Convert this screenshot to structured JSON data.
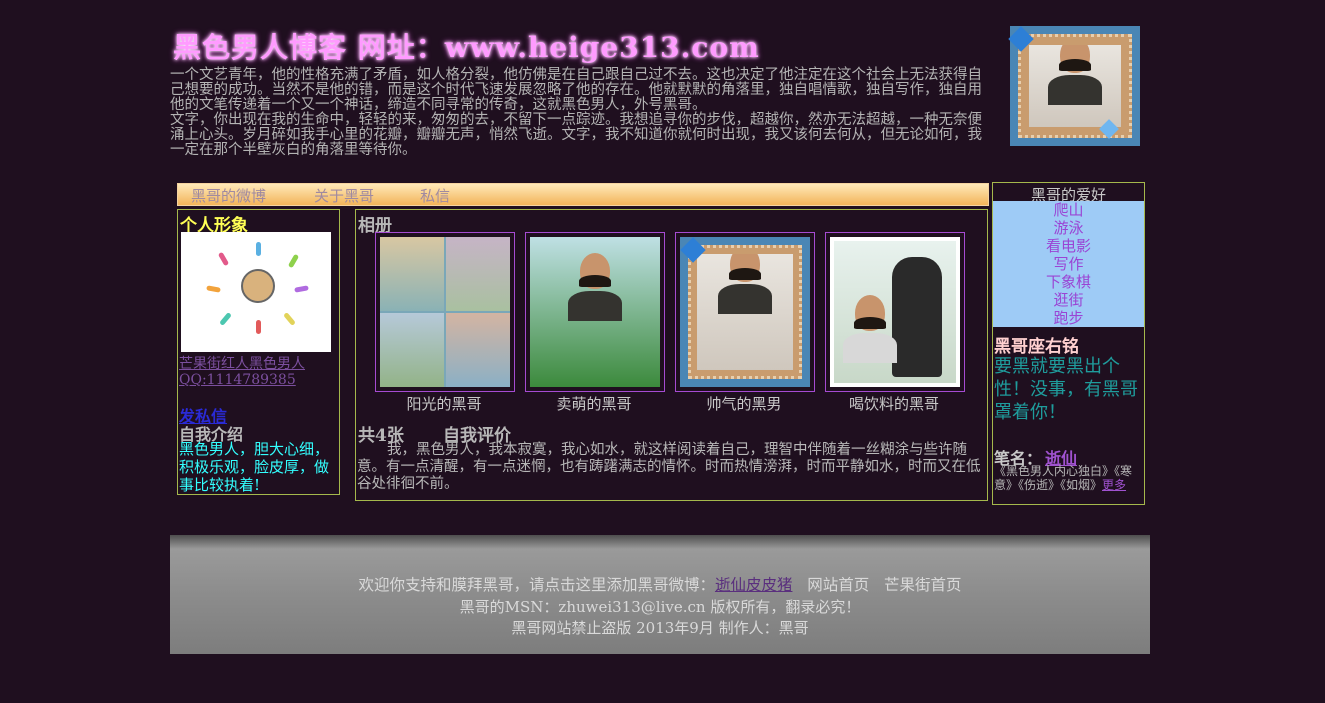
{
  "header": {
    "title": "黑色男人博客 网址：www.heige313.com",
    "intro_p1": "一个文艺青年，他的性格充满了矛盾，如人格分裂，他仿佛是在自己跟自己过不去。这也决定了他注定在这个社会上无法获得自己想要的成功。当然不是他的错，而是这个时代飞速发展忽略了他的存在。他就默默的角落里，独自唱情歌，独自写作，独自用他的文笔传递着一个又一个神话，缔造不同寻常的传奇，这就黑色男人，外号黑哥。",
    "intro_p2": "文字，你出现在我的生命中，轻轻的来，匆匆的去，不留下一点踪迹。我想追寻你的步伐，超越你，然亦无法超越，一种无奈便涌上心头。岁月碎如我手心里的花瓣，瓣瓣无声，悄然飞逝。文字，我不知道你就何时出现，我又该何去何从，但无论如何，我一定在那个半壁灰白的角落里等待你。"
  },
  "nav": {
    "items": [
      "黑哥的微博",
      "关于黑哥",
      "私信"
    ]
  },
  "profile": {
    "title": "个人形象",
    "link_name": "芒果街红人黑色男人",
    "qq": "QQ:1114789385",
    "message_link": "发私信",
    "intro_label": "自我介绍",
    "intro_text": "黑色男人，胆大心细，积极乐观，脸皮厚，做事比较执着!"
  },
  "album": {
    "title": "相册",
    "photos": [
      {
        "caption": "阳光的黑哥"
      },
      {
        "caption": "卖萌的黑哥"
      },
      {
        "caption": "帅气的黑男"
      },
      {
        "caption": "喝饮料的黑哥"
      }
    ],
    "count": "共4张",
    "eval_label": "自我评价",
    "eval_text": "我，黑色男人，我本寂寞，我心如水，就这样阅读着自己，理智中伴随着一丝糊涂与些许随意。有一点清醒，有一点迷惘，也有踌躇满志的情怀。时而热情滂湃，时而平静如水，时而又在低谷处徘徊不前。"
  },
  "sidebar": {
    "hobby_title": "黑哥的爱好",
    "hobbies": [
      "爬山",
      "游泳",
      "看电影",
      "写作",
      "下象棋",
      "逛街",
      "跑步"
    ],
    "motto_title": "黑哥座右铭",
    "motto": "要黑就要黑出个性！没事，有黑哥罩着你！",
    "pen_label": "笔名：",
    "pen_name": "逝仙",
    "works": "《黑色男人内心独白》《寒意》《伤逝》《如烟》",
    "more": "更多"
  },
  "footer": {
    "line1_prefix": "欢迎你支持和膜拜黑哥，请点击这里添加黑哥微博：",
    "weibo_link": "逝仙皮皮猪",
    "site_home": "网站首页",
    "mango_home": "芒果街首页",
    "line2": "黑哥的MSN：zhuwei313@live.cn   版权所有，翻录必究！",
    "line3": "黑哥网站禁止盗版 2013年9月 制作人：黑哥"
  },
  "colors": {
    "background": "#1f0f1f",
    "title_pink": "#ff9bff",
    "accent_yellow": "#ffff55",
    "cyan_text": "#33ffff",
    "hobby_bg": "#9ecbf6",
    "link_purple": "#a052d0"
  }
}
